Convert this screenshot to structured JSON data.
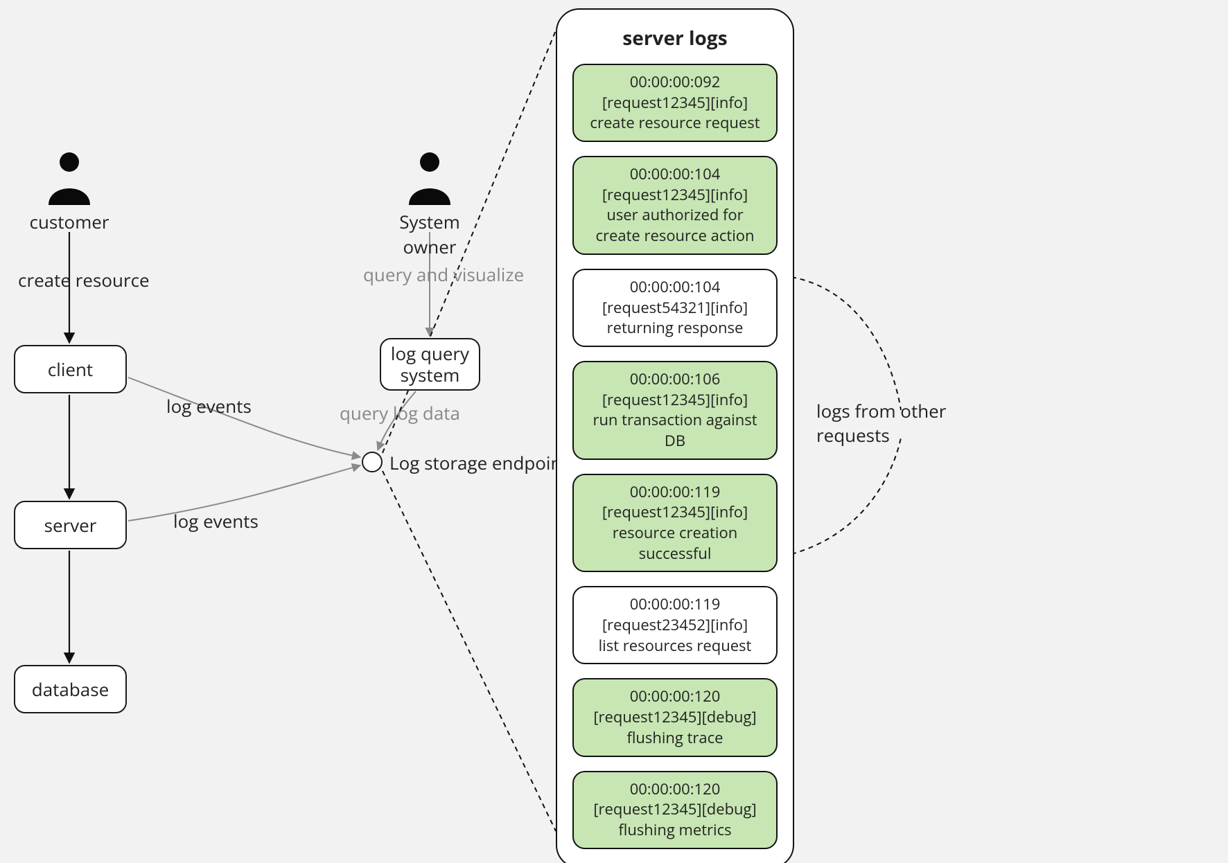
{
  "actors": {
    "customer": "customer",
    "system_owner": "System owner"
  },
  "nodes": {
    "client": "client",
    "server": "server",
    "database": "database",
    "log_query_system": "log query\nsystem",
    "log_storage_endpoint": "Log storage endpoint"
  },
  "edges": {
    "create_resource": "create resource",
    "log_events_client": "log events",
    "log_events_server": "log events",
    "query_and_visualize": "query and visualize",
    "query_log_data": "query log data"
  },
  "log_panel": {
    "title": "server logs",
    "entries": [
      {
        "style": "h",
        "ts": "00:00:00:092",
        "tag": "[request12345][info]",
        "msg": "create resource request"
      },
      {
        "style": "h",
        "ts": "00:00:00:104",
        "tag": "[request12345][info]",
        "msg": "user authorized for create resource action"
      },
      {
        "style": "w",
        "ts": "00:00:00:104",
        "tag": "[request54321][info]",
        "msg": "returning response"
      },
      {
        "style": "h",
        "ts": "00:00:00:106",
        "tag": "[request12345][info]",
        "msg": "run transaction against DB"
      },
      {
        "style": "h",
        "ts": "00:00:00:119",
        "tag": "[request12345][info]",
        "msg": "resource creation successful"
      },
      {
        "style": "w",
        "ts": "00:00:00:119",
        "tag": "[request23452][info]",
        "msg": "list resources request"
      },
      {
        "style": "h",
        "ts": "00:00:00:120",
        "tag": "[request12345][debug]",
        "msg": "flushing trace"
      },
      {
        "style": "h",
        "ts": "00:00:00:120",
        "tag": "[request12345][debug]",
        "msg": "flushing metrics"
      }
    ]
  },
  "annotation": {
    "other_requests": "logs from other\nrequests"
  }
}
